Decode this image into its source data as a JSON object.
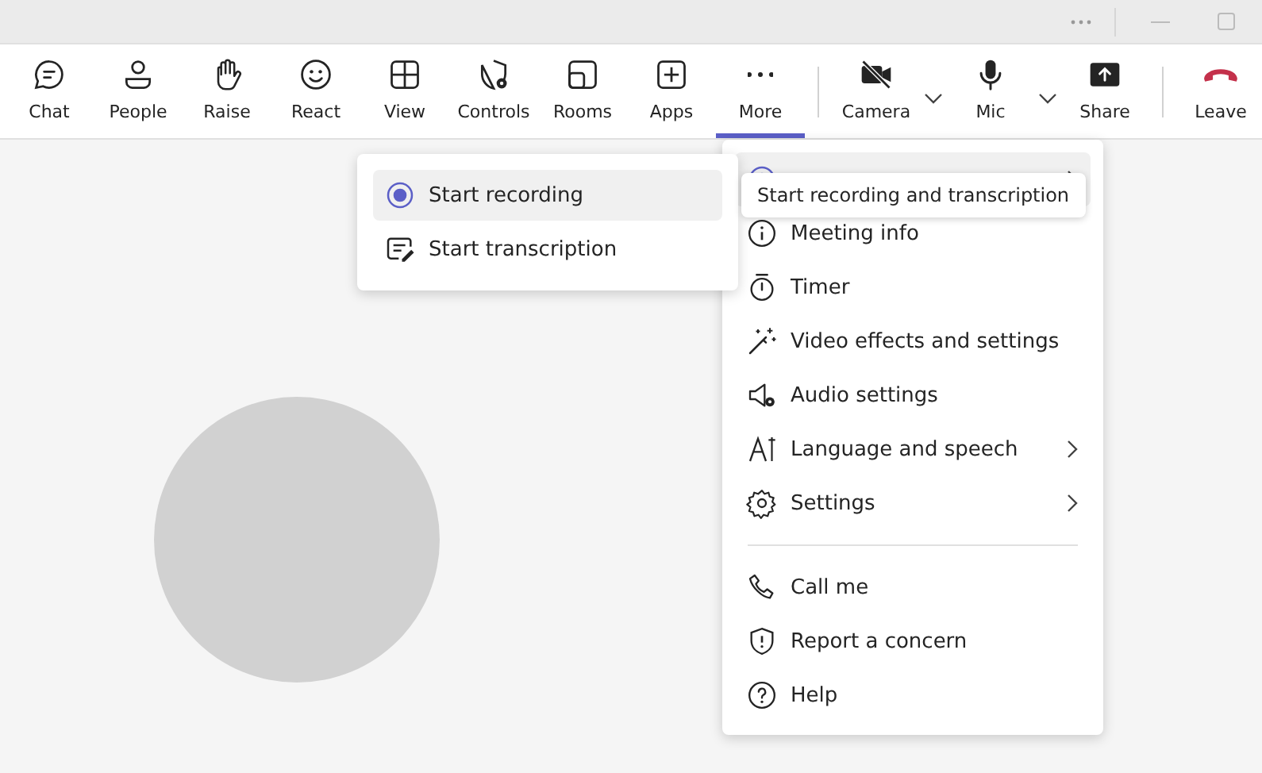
{
  "toolbar": {
    "items": [
      {
        "label": "Chat",
        "kind": "chat",
        "selected": false,
        "dropdown": false
      },
      {
        "label": "People",
        "kind": "people",
        "selected": false,
        "dropdown": false
      },
      {
        "label": "Raise",
        "kind": "raise",
        "selected": false,
        "dropdown": false
      },
      {
        "label": "React",
        "kind": "react",
        "selected": false,
        "dropdown": false
      },
      {
        "label": "View",
        "kind": "view",
        "selected": false,
        "dropdown": false
      },
      {
        "label": "Controls",
        "kind": "controls",
        "selected": false,
        "dropdown": false
      },
      {
        "label": "Rooms",
        "kind": "rooms",
        "selected": false,
        "dropdown": false
      },
      {
        "label": "Apps",
        "kind": "apps",
        "selected": false,
        "dropdown": false
      },
      {
        "label": "More",
        "kind": "more",
        "selected": true,
        "dropdown": false
      },
      {
        "kind": "separator"
      },
      {
        "label": "Camera",
        "kind": "camera",
        "selected": false,
        "dropdown": true
      },
      {
        "label": "Mic",
        "kind": "mic",
        "selected": false,
        "dropdown": true
      },
      {
        "label": "Share",
        "kind": "share",
        "selected": false,
        "dropdown": false
      },
      {
        "kind": "separator"
      },
      {
        "label": "Leave",
        "kind": "leave",
        "selected": false,
        "dropdown": false
      }
    ]
  },
  "more_menu": {
    "items": [
      {
        "kind": "record",
        "highlighted": true,
        "submenu": true
      },
      {
        "kind": "info",
        "label": "Meeting info",
        "highlighted": false,
        "submenu": false
      },
      {
        "kind": "timer",
        "label": "Timer",
        "highlighted": false,
        "submenu": false
      },
      {
        "kind": "effects",
        "label": "Video effects and settings",
        "highlighted": false,
        "submenu": false
      },
      {
        "kind": "audio",
        "label": "Audio settings",
        "highlighted": false,
        "submenu": false
      },
      {
        "kind": "language",
        "label": "Language and speech",
        "highlighted": false,
        "submenu": true
      },
      {
        "kind": "settings",
        "label": "Settings",
        "highlighted": false,
        "submenu": true
      },
      {
        "kind": "divider"
      },
      {
        "kind": "call",
        "label": "Call me",
        "highlighted": false,
        "submenu": false
      },
      {
        "kind": "report",
        "label": "Report a concern",
        "highlighted": false,
        "submenu": false
      },
      {
        "kind": "help",
        "label": "Help",
        "highlighted": false,
        "submenu": false
      }
    ]
  },
  "submenu": {
    "items": [
      {
        "label": "Start recording",
        "kind": "record",
        "selected": true
      },
      {
        "label": "Start transcription",
        "kind": "transcript",
        "selected": false
      }
    ]
  },
  "tooltip": {
    "text": "Start recording and transcription"
  }
}
